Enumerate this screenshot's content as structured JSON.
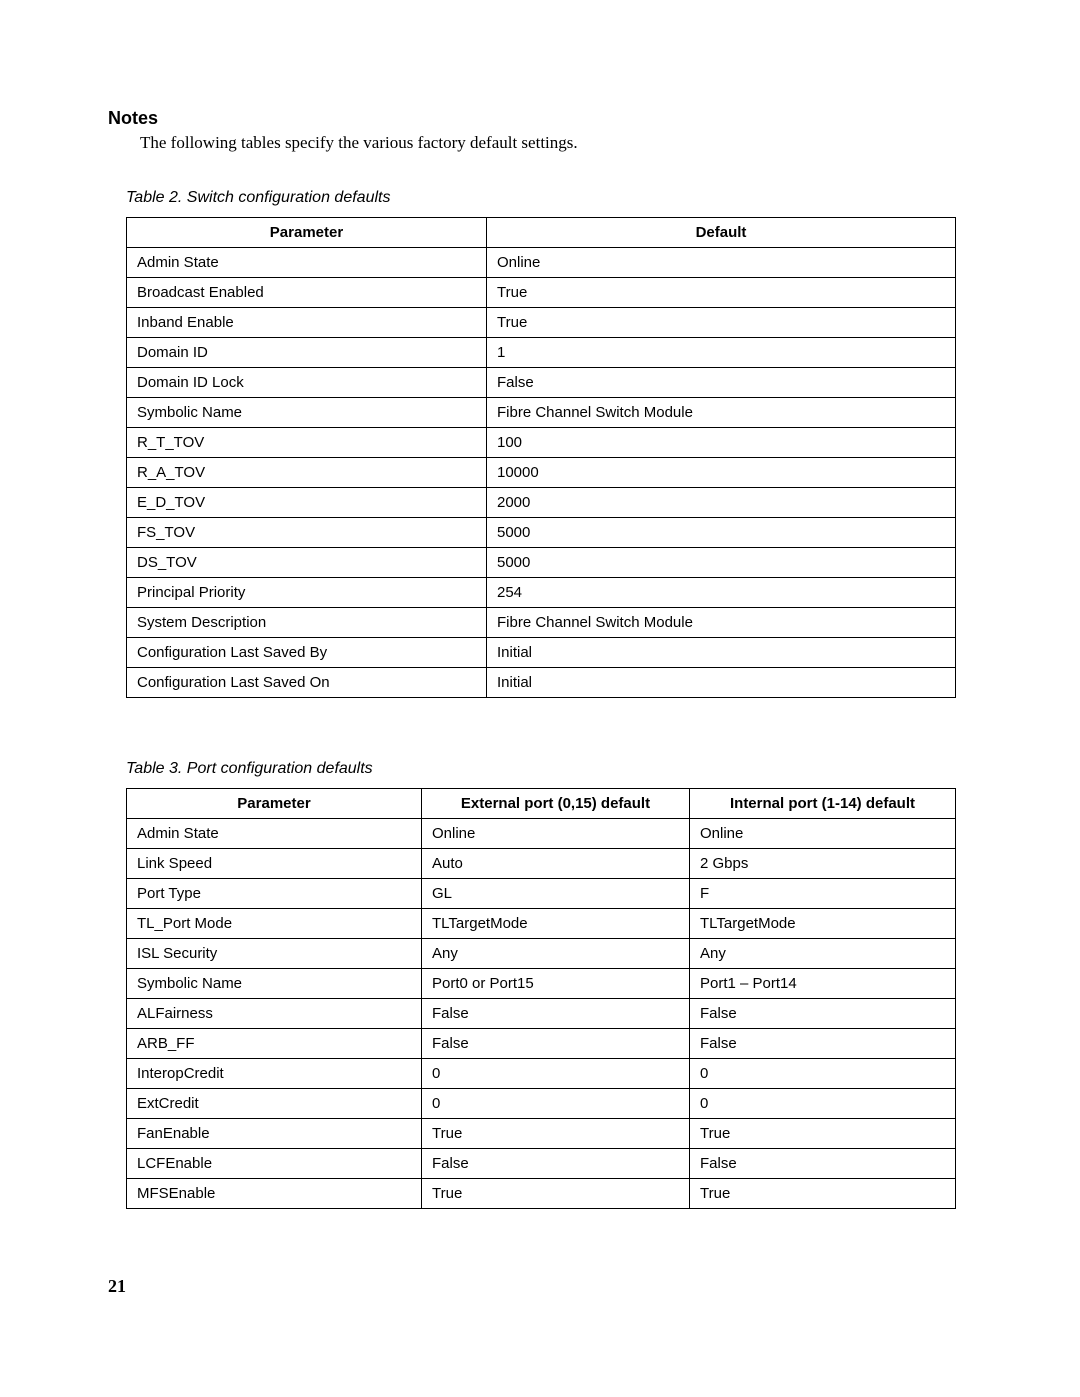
{
  "heading": "Notes",
  "intro": "The following tables specify the various factory default settings.",
  "table2": {
    "caption": "Table 2. Switch configuration defaults",
    "headers": [
      "Parameter",
      "Default"
    ],
    "rows": [
      [
        "Admin State",
        "Online"
      ],
      [
        "Broadcast Enabled",
        "True"
      ],
      [
        "Inband Enable",
        "True"
      ],
      [
        "Domain ID",
        "1"
      ],
      [
        "Domain ID Lock",
        "False"
      ],
      [
        "Symbolic Name",
        "Fibre Channel Switch Module"
      ],
      [
        "R_T_TOV",
        "100"
      ],
      [
        "R_A_TOV",
        "10000"
      ],
      [
        "E_D_TOV",
        "2000"
      ],
      [
        "FS_TOV",
        "5000"
      ],
      [
        "DS_TOV",
        "5000"
      ],
      [
        "Principal Priority",
        "254"
      ],
      [
        "System Description",
        " Fibre Channel Switch Module"
      ],
      [
        "Configuration Last Saved By",
        "Initial"
      ],
      [
        "Configuration Last Saved On",
        "Initial"
      ]
    ]
  },
  "table3": {
    "caption": "Table 3. Port configuration defaults",
    "headers": [
      "Parameter",
      "External port (0,15) default",
      "Internal port (1-14) default"
    ],
    "rows": [
      [
        "Admin State",
        "Online",
        "Online"
      ],
      [
        "Link Speed",
        "Auto",
        "2 Gbps"
      ],
      [
        "Port Type",
        "GL",
        "F"
      ],
      [
        "TL_Port Mode",
        "TLTargetMode",
        "TLTargetMode"
      ],
      [
        "ISL Security",
        "Any",
        "Any"
      ],
      [
        "Symbolic Name",
        "Port0 or Port15",
        "Port1 – Port14"
      ],
      [
        "ALFairness",
        "False",
        "False"
      ],
      [
        "ARB_FF",
        "False",
        "False"
      ],
      [
        "InteropCredit",
        "0",
        "0"
      ],
      [
        "ExtCredit",
        "0",
        "0"
      ],
      [
        "FanEnable",
        "True",
        "True"
      ],
      [
        "LCFEnable",
        "False",
        "False"
      ],
      [
        "MFSEnable",
        "True",
        "True"
      ]
    ]
  },
  "page_number": "21"
}
